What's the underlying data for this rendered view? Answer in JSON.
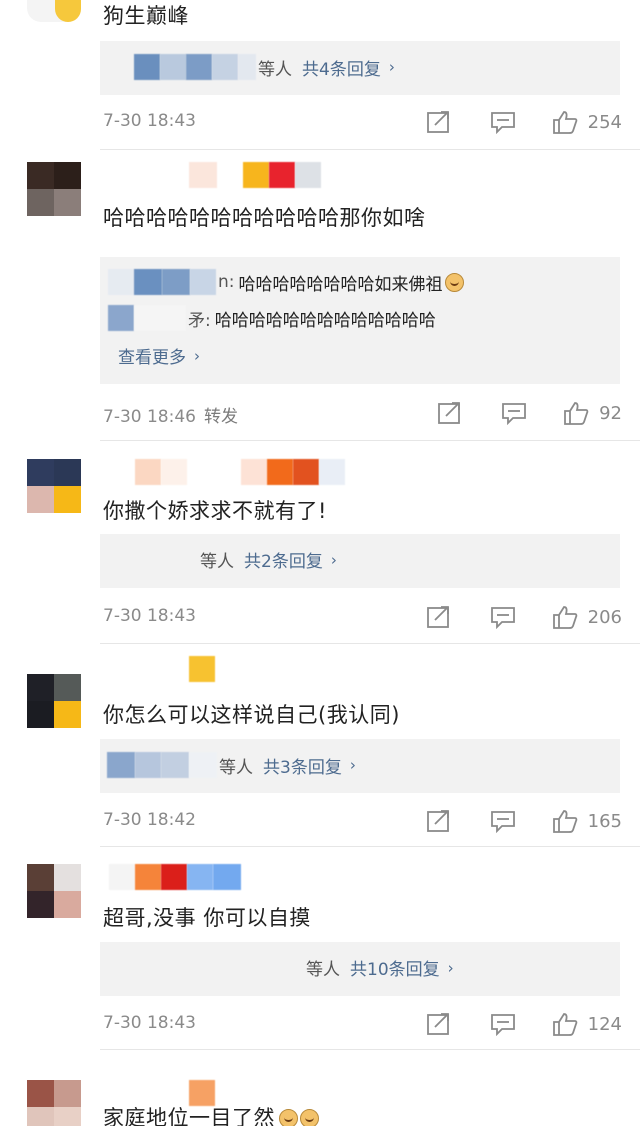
{
  "comments": [
    {
      "text": "狗生巅峰",
      "reply_suffix": "等人",
      "reply_link": "共4条回复",
      "time": "7-30 18:43",
      "likes": "254"
    },
    {
      "text": "哈哈哈哈哈哈哈哈哈哈哈那你如啥",
      "replies": [
        {
          "user_tail": "n:",
          "text": "哈哈哈哈哈哈哈哈如来佛祖"
        },
        {
          "user_tail": "矛:",
          "text": "哈哈哈哈哈哈哈哈哈哈哈哈哈"
        }
      ],
      "more": "查看更多",
      "time": "7-30 18:46",
      "forward": "转发",
      "likes": "92"
    },
    {
      "text": "你撒个娇求求不就有了!",
      "reply_suffix": "等人",
      "reply_link": "共2条回复",
      "time": "7-30 18:43",
      "likes": "206"
    },
    {
      "text": "你怎么可以这样说自己(我认同)",
      "reply_suffix": "等人",
      "reply_link": "共3条回复",
      "time": "7-30 18:42",
      "likes": "165"
    },
    {
      "text": "超哥,没事 你可以自摸",
      "reply_suffix": "等人",
      "reply_link": "共10条回复",
      "time": "7-30 18:43",
      "likes": "124"
    },
    {
      "text": "家庭地位一目了然"
    }
  ],
  "icons": {
    "share": "share-icon",
    "comment": "comment-icon",
    "like": "thumbs-up-icon",
    "chevron": "chevron-right-icon"
  },
  "colors": {
    "link": "#4d6b8f",
    "meta": "#8a8a8a",
    "reply_bg": "#f2f2f2"
  }
}
